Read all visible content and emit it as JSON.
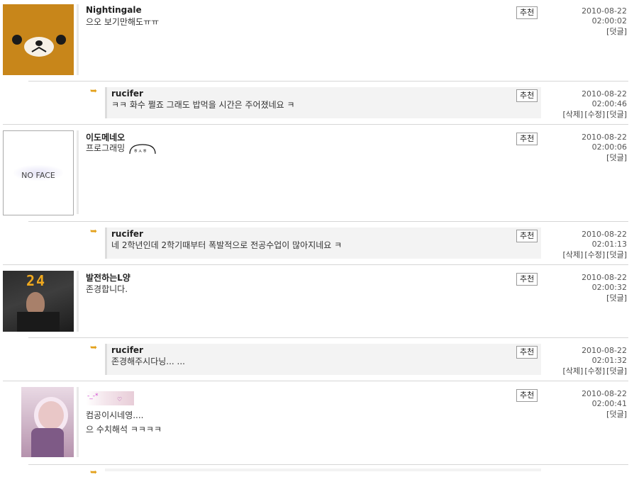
{
  "comments": [
    {
      "nick": "Nightingale",
      "text": "으오 보기만해도ㅠㅠ",
      "date": "2010-08-22",
      "time": "02:00:02",
      "actions": [
        "[덧글]"
      ],
      "recommend": "추천"
    },
    {
      "nick": "rucifer",
      "text": "ㅋㅋ 화수 쩔죠 그래도 밥먹을 시간은 주어졌네요 ㅋ",
      "date": "2010-08-22",
      "time": "02:00:46",
      "actions": [
        "[삭제]",
        "[수정]",
        "[덧글]"
      ],
      "recommend": "추천"
    },
    {
      "nick": "이도메네오",
      "text": "프로그래밍",
      "avatar_text": "NO FACE",
      "date": "2010-08-22",
      "time": "02:00:06",
      "actions": [
        "[덧글]"
      ],
      "recommend": "추천"
    },
    {
      "nick": "rucifer",
      "text": "네 2학년인데 2학기때부터 폭발적으로 전공수업이 많아지네요 ㅋ",
      "date": "2010-08-22",
      "time": "02:01:13",
      "actions": [
        "[삭제]",
        "[수정]",
        "[덧글]"
      ],
      "recommend": "추천"
    },
    {
      "nick": "발전하는L양",
      "text": "존경합니다.",
      "avatar_text": "24",
      "date": "2010-08-22",
      "time": "02:00:32",
      "actions": [
        "[덧글]"
      ],
      "recommend": "추천"
    },
    {
      "nick": "rucifer",
      "text": "존경해주시다닝... ...",
      "date": "2010-08-22",
      "time": "02:01:32",
      "actions": [
        "[삭제]",
        "[수정]",
        "[덧글]"
      ],
      "recommend": "추천"
    },
    {
      "nick": "",
      "line1": "컴공이시네영....",
      "line2": "으 수치해석 ㅋㅋㅋㅋ",
      "date": "2010-08-22",
      "time": "02:00:41",
      "actions": [
        "[덧글]"
      ],
      "recommend": "추천"
    }
  ],
  "icons": {
    "reply": "reply-arrow-icon",
    "bear": "bear-face-icon",
    "no_face": "no-face-icon",
    "tv": "tv-24-icon",
    "girl": "girl-photo-icon"
  }
}
